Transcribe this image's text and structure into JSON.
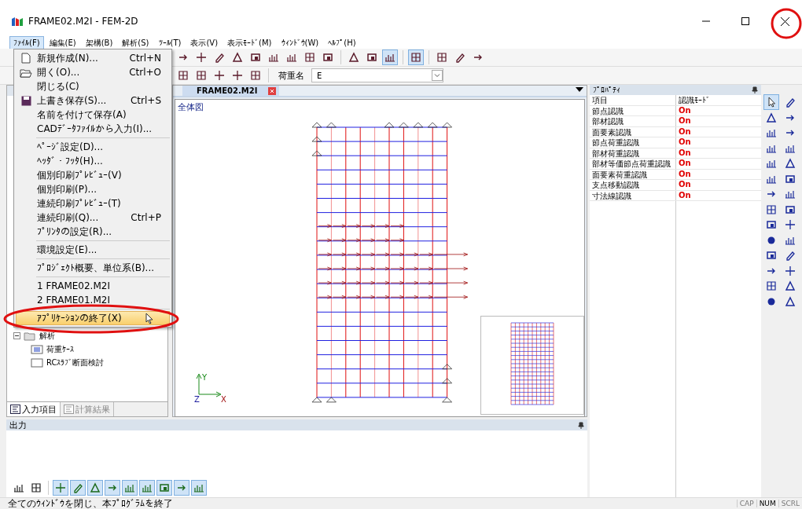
{
  "window": {
    "title": "FRAME02.M2I - FEM-2D"
  },
  "menubar": [
    {
      "label": "ﾌｧｲﾙ(F)",
      "selected": true
    },
    {
      "label": "編集(E)",
      "selected": false
    },
    {
      "label": "架構(B)",
      "selected": false
    },
    {
      "label": "解析(S)",
      "selected": false
    },
    {
      "label": "ﾂｰﾙ(T)",
      "selected": false
    },
    {
      "label": "表示(V)",
      "selected": false
    },
    {
      "label": "表示ﾓｰﾄﾞ(M)",
      "selected": false
    },
    {
      "label": "ｳｨﾝﾄﾞｳ(W)",
      "selected": false
    },
    {
      "label": "ﾍﾙﾌﾟ(H)",
      "selected": false
    }
  ],
  "file_menu": [
    {
      "kind": "item",
      "label": "新規作成(N)...",
      "shortcut": "Ctrl+N",
      "selected": false
    },
    {
      "kind": "item",
      "label": "開く(O)...",
      "shortcut": "Ctrl+O",
      "selected": false
    },
    {
      "kind": "item",
      "label": "閉じる(C)",
      "selected": false
    },
    {
      "kind": "item",
      "label": "上書き保存(S)...",
      "shortcut": "Ctrl+S",
      "selected": false
    },
    {
      "kind": "item",
      "label": "名前を付けて保存(A)",
      "selected": false
    },
    {
      "kind": "item",
      "label": "CADﾃﾞｰﾀﾌｧｲﾙから入力(I)...",
      "selected": false
    },
    {
      "kind": "separator"
    },
    {
      "kind": "item",
      "label": "ﾍﾟｰｼﾞ設定(D)...",
      "selected": false
    },
    {
      "kind": "item",
      "label": "ﾍｯﾀﾞ・ﾌｯﾀ(H)...",
      "selected": false
    },
    {
      "kind": "item",
      "label": "個別印刷ﾌﾟﾚﾋﾞｭｰ(V)",
      "selected": false
    },
    {
      "kind": "item",
      "label": "個別印刷(P)...",
      "selected": false
    },
    {
      "kind": "item",
      "label": "連続印刷ﾌﾟﾚﾋﾞｭｰ(T)",
      "selected": false
    },
    {
      "kind": "item",
      "label": "連続印刷(Q)...",
      "shortcut": "Ctrl+P",
      "selected": false
    },
    {
      "kind": "item",
      "label": "ﾌﾟﾘﾝﾀの設定(R)...",
      "selected": false
    },
    {
      "kind": "separator"
    },
    {
      "kind": "item",
      "label": "環境設定(E)...",
      "selected": false
    },
    {
      "kind": "separator"
    },
    {
      "kind": "item",
      "label": "ﾌﾟﾛｼﾞｪｸﾄ概要、単位系(B)...",
      "selected": false
    },
    {
      "kind": "separator"
    },
    {
      "kind": "item",
      "label": "1 FRAME02.M2I",
      "selected": false
    },
    {
      "kind": "item",
      "label": "2 FRAME01.M2I",
      "selected": false
    },
    {
      "kind": "separator"
    },
    {
      "kind": "item",
      "label": "ｱﾌﾟﾘｹｰｼｮﾝの終了(X)",
      "selected": true
    }
  ],
  "load_name": {
    "label": "荷重名",
    "value": "E"
  },
  "tree": [
    {
      "label": "解析",
      "expanded": true,
      "children": [
        {
          "label": "荷重ｹｰｽ"
        },
        {
          "label": "RCｽﾗﾌﾞ断面検討"
        }
      ]
    }
  ],
  "left_tabs": [
    {
      "label": "入力項目",
      "selected": true
    },
    {
      "label": "計算結果",
      "selected": false
    }
  ],
  "document": {
    "tab": "FRAME02.M2I",
    "view_label": "全体図",
    "axes": {
      "y": "Y",
      "z": "Z",
      "x": "X"
    }
  },
  "properties": {
    "title": "ﾌﾟﾛﾊﾟﾃｨ",
    "columns": [
      "項目",
      "認識ﾓｰﾄﾞ"
    ],
    "rows": [
      {
        "name": "節点認識",
        "value": "On"
      },
      {
        "name": "部材認識",
        "value": "On"
      },
      {
        "name": "面要素認識",
        "value": "On"
      },
      {
        "name": "節点荷重認識",
        "value": "On"
      },
      {
        "name": "部材荷重認識",
        "value": "On"
      },
      {
        "name": "部材等価節点荷重認識",
        "value": "On"
      },
      {
        "name": "面要素荷重認識",
        "value": "On"
      },
      {
        "name": "支点移動認識",
        "value": "On"
      },
      {
        "name": "寸法線認識",
        "value": "On"
      }
    ]
  },
  "output": {
    "title": "出力"
  },
  "status_bar": {
    "text": "全てのｳｨﾝﾄﾞｳを閉じ、本ﾌﾟﾛｸﾞﾗﾑを終了",
    "indicators": [
      {
        "label": "CAP",
        "on": false
      },
      {
        "label": "NUM",
        "on": true
      },
      {
        "label": "SCRL",
        "on": false
      }
    ]
  }
}
